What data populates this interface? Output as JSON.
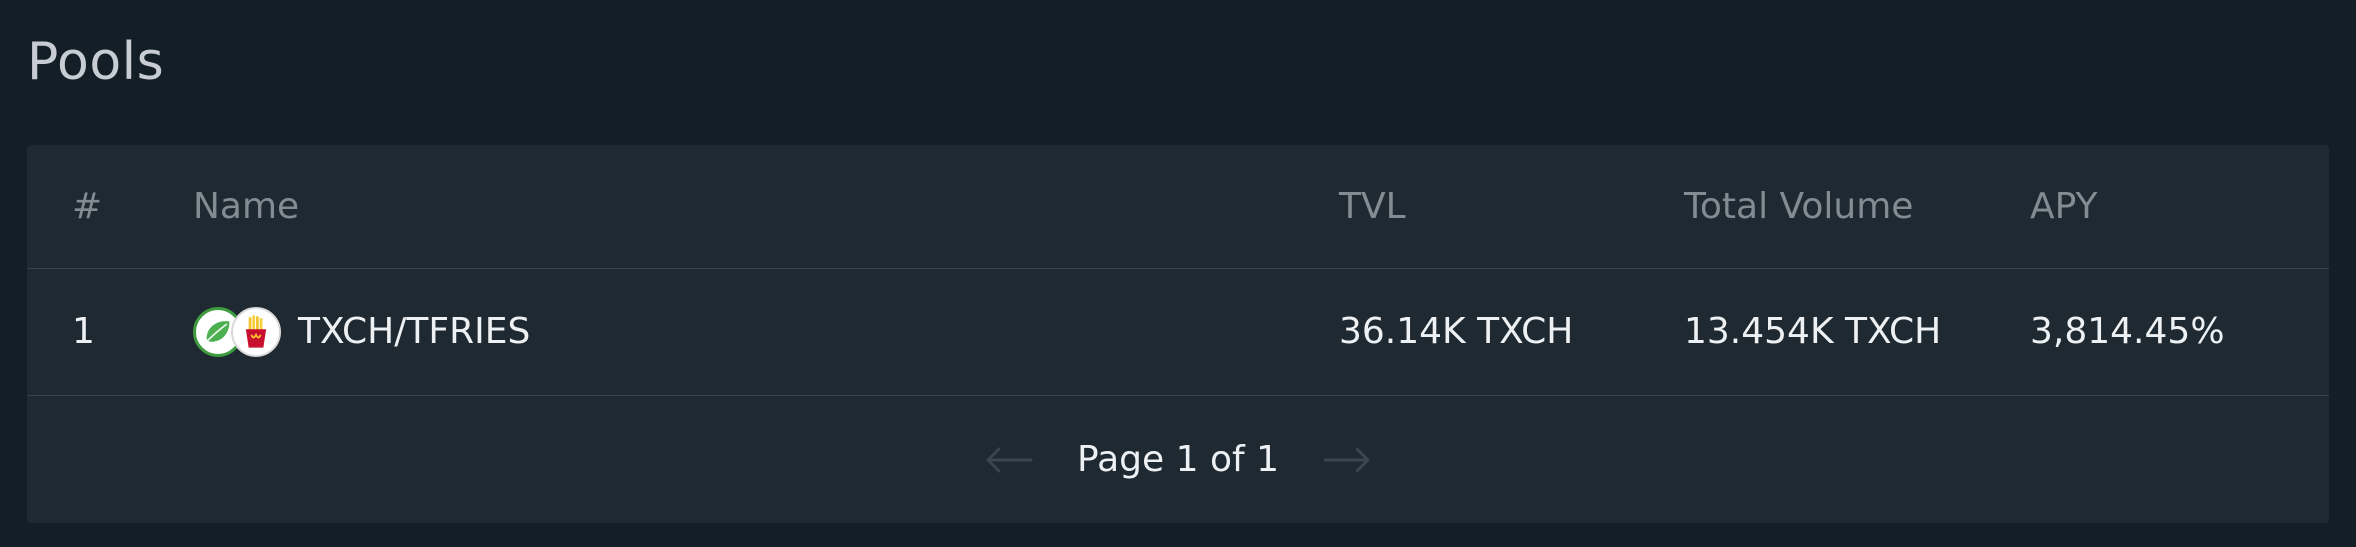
{
  "page": {
    "title": "Pools"
  },
  "table": {
    "headers": {
      "index": "#",
      "name": "Name",
      "tvl": "TVL",
      "volume": "Total Volume",
      "apy": "APY"
    },
    "rows": [
      {
        "index": "1",
        "name": "TXCH/TFRIES",
        "token_a_icon": "leaf-icon",
        "token_b_icon": "fries-icon",
        "tvl": "36.14K TXCH",
        "volume": "13.454K TXCH",
        "apy": "3,814.45%"
      }
    ]
  },
  "pagination": {
    "label": "Page 1 of 1",
    "prev_icon": "arrow-left-icon",
    "next_icon": "arrow-right-icon"
  },
  "colors": {
    "background": "#141e26",
    "card": "#1e2931",
    "divider": "#37424b",
    "header_text": "#838c93",
    "body_text": "#eef1f3",
    "leaf_green": "#3f9b3f",
    "fries_red": "#c8102e"
  }
}
